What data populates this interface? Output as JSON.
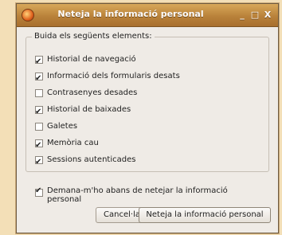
{
  "window": {
    "title": "Neteja la informació personal",
    "controls": {
      "minimize": "_",
      "maximize": "□",
      "close": "X"
    }
  },
  "group": {
    "title": "Buida els següents elements:",
    "items": [
      {
        "label": "Historial de navegació",
        "checked": true
      },
      {
        "label": "Informació dels formularis desats",
        "checked": true
      },
      {
        "label": "Contrasenyes desades",
        "checked": false
      },
      {
        "label": "Historial de baixades",
        "checked": true
      },
      {
        "label": "Galetes",
        "checked": false
      },
      {
        "label": "Memòria cau",
        "checked": true
      },
      {
        "label": "Sessions autenticades",
        "checked": true
      }
    ]
  },
  "ask": {
    "label": "Demana-m'ho abans de netejar la informació personal",
    "checked": true
  },
  "buttons": {
    "cancel": "Cancel·la",
    "clear": "Neteja la informació personal"
  },
  "colors": {
    "titlebar": "#b9823a",
    "window_bg": "#efebe6",
    "desktop_bg": "#f3dfb7"
  }
}
